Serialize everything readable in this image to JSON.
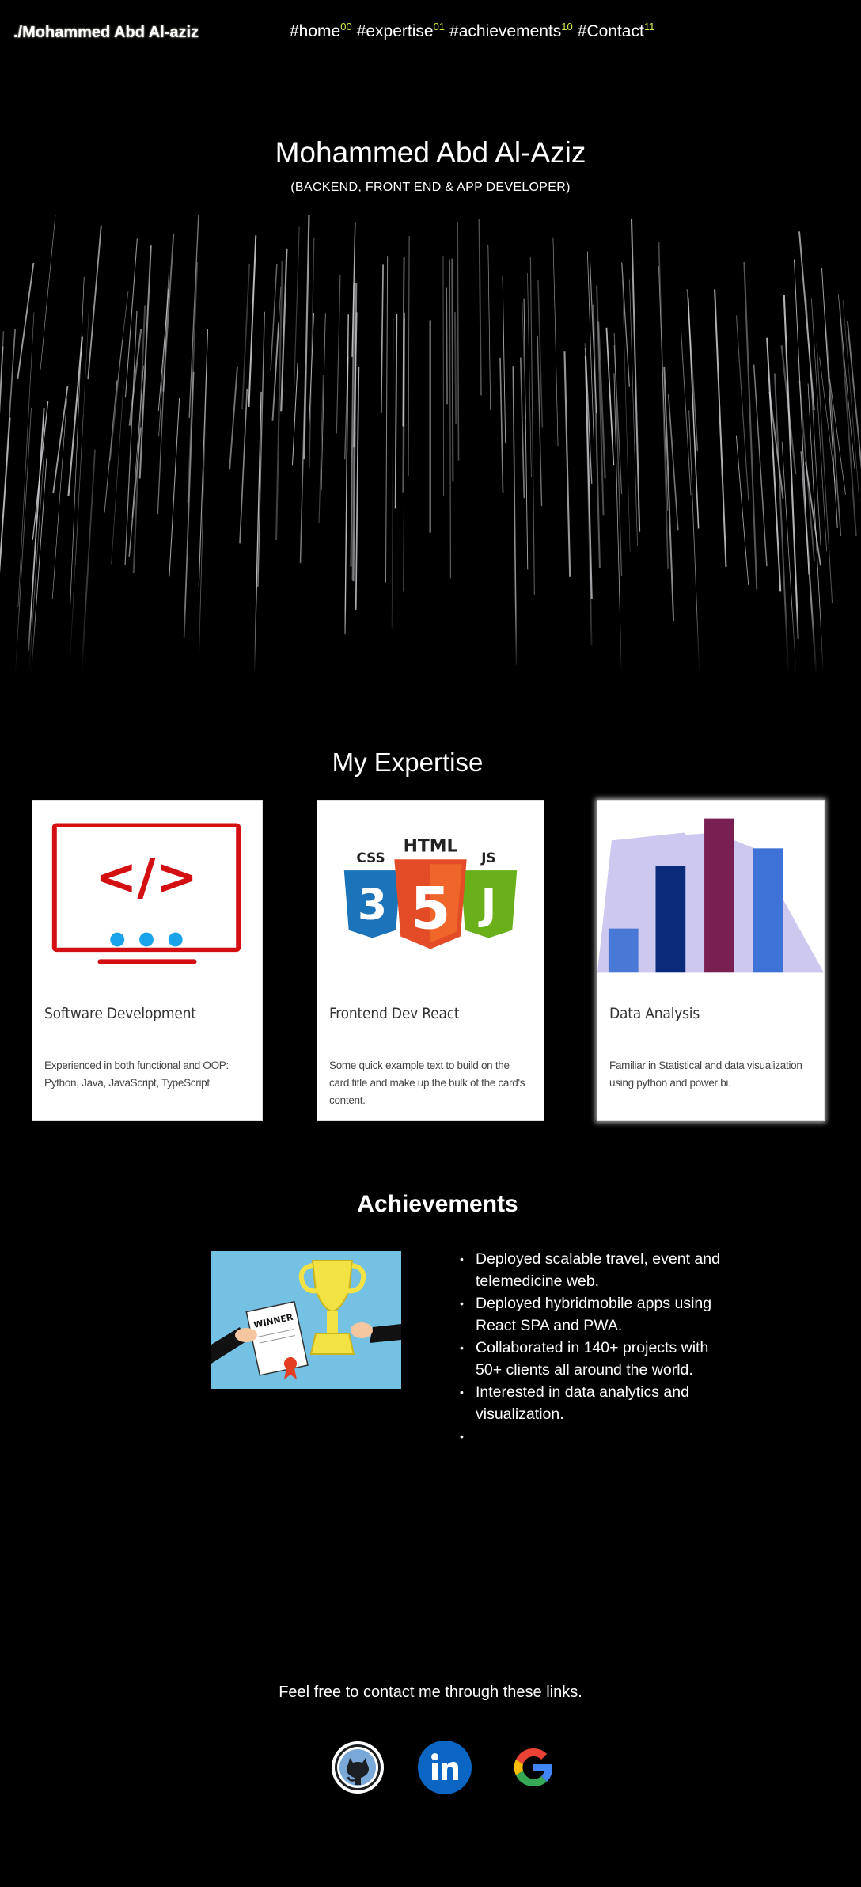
{
  "nav": {
    "brand": "./Mohammed Abd Al-aziz",
    "links": [
      {
        "label": "#home",
        "num": "00"
      },
      {
        "label": "#expertise",
        "num": "01"
      },
      {
        "label": "#achievements",
        "num": "10"
      },
      {
        "label": "#Contact",
        "num": "11"
      }
    ]
  },
  "hero": {
    "title": "Mohammed Abd Al-Aziz",
    "subtitle": "(BACKEND, FRONT END &  APP DEVELOPER)"
  },
  "expertise": {
    "heading": "My Expertise",
    "cards": [
      {
        "title": "Software Development",
        "text": "Experienced in both functional and OOP: Python, Java, JavaScript, TypeScript.",
        "icon": "code-monitor-icon"
      },
      {
        "title": "Frontend Dev React",
        "text": "Some quick example text to build on the card title and make up the bulk of the card's content.",
        "icon": "html-css-js-icon",
        "logo_labels": [
          "CSS",
          "HTML",
          "JS"
        ]
      },
      {
        "title": "Data Analysis",
        "text": "Familiar in Statistical and data visualization using python and power bi.",
        "icon": "bar-chart-icon"
      }
    ]
  },
  "achievements": {
    "heading": "Achievements",
    "image_label": "WINNER",
    "items": [
      "Deployed scalable travel, event and telemedicine web.",
      "Deployed hybridmobile apps using React SPA and PWA.",
      "Collaborated in 140+ projects with 50+ clients all around the world.",
      "Interested in data analytics and visualization.",
      ""
    ]
  },
  "contact": {
    "text": "Feel free to contact me through these links.",
    "links": [
      "github-icon",
      "linkedin-icon",
      "google-icon"
    ]
  },
  "colors": {
    "background": "#000000",
    "accent_number": "#d7e84a",
    "code_red": "#d40f12",
    "dot_blue": "#1aa3e8"
  }
}
